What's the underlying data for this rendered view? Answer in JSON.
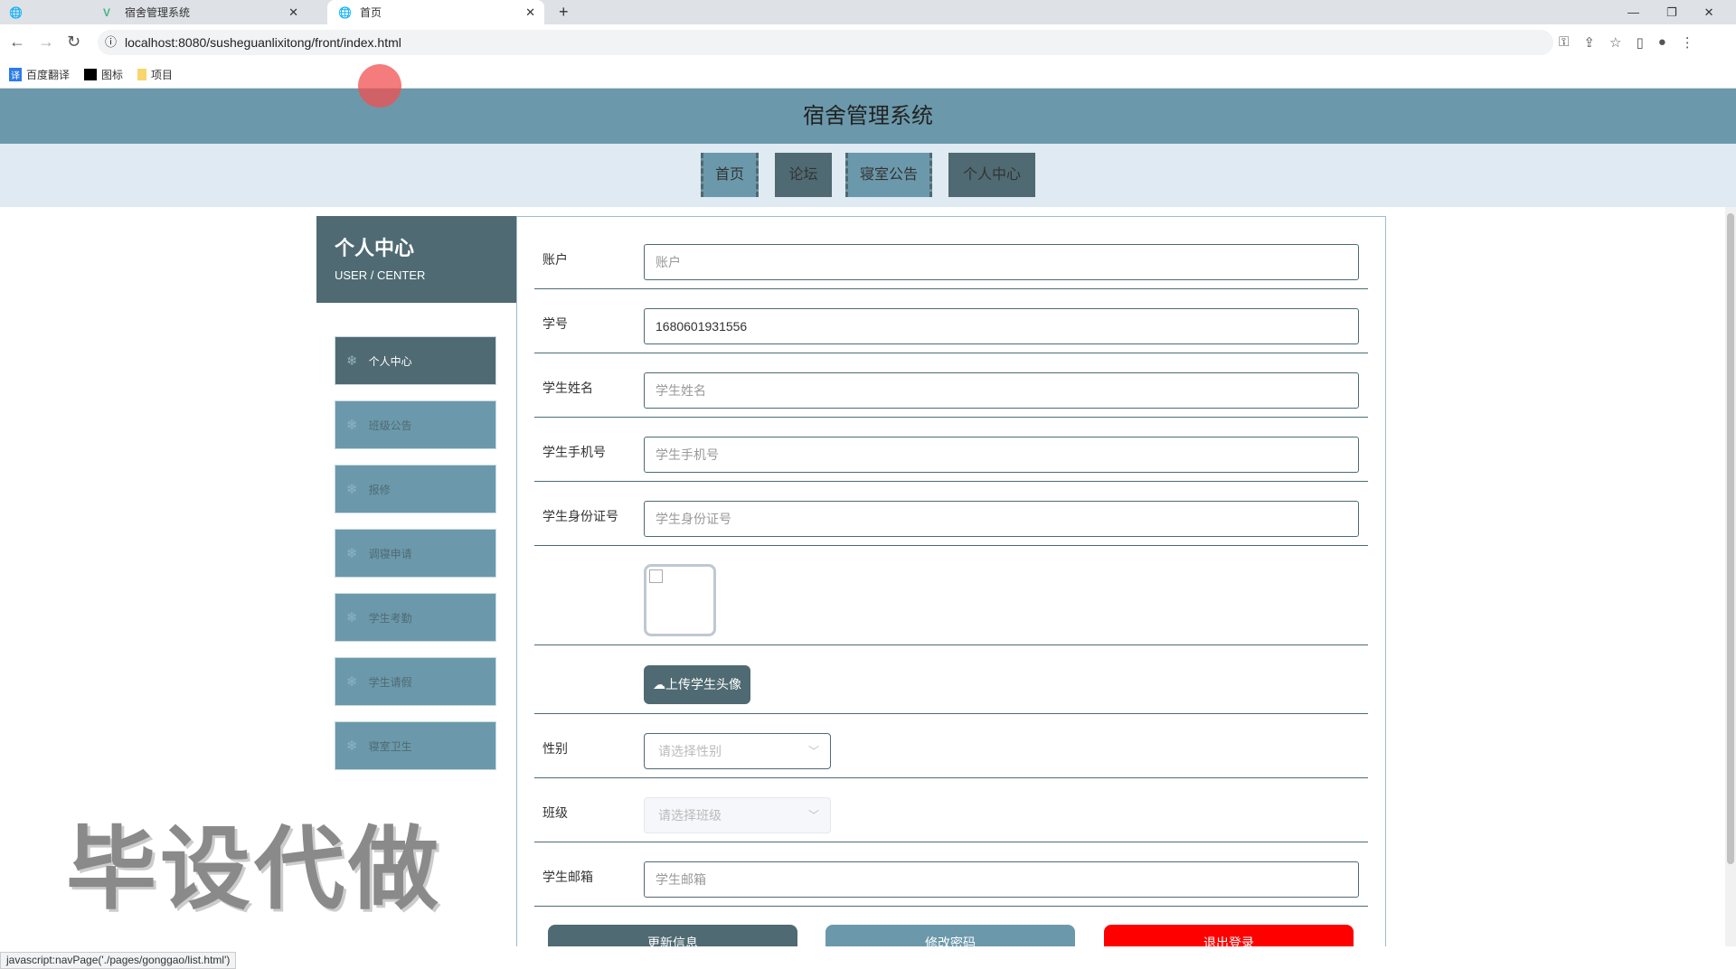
{
  "browser": {
    "tabs": [
      {
        "title": "宿舍管理系统"
      },
      {
        "title": "首页"
      }
    ],
    "url": "localhost:8080/susheguanlixitong/front/index.html",
    "bookmarks": [
      "百度翻译",
      "图标",
      "项目"
    ],
    "status": "javascript:navPage('./pages/gonggao/list.html')"
  },
  "header": {
    "title": "宿舍管理系统"
  },
  "nav": [
    "首页",
    "论坛",
    "寝室公告",
    "个人中心"
  ],
  "sidebar": {
    "title": "个人中心",
    "subtitle": "USER / CENTER",
    "items": [
      "个人中心",
      "班级公告",
      "报修",
      "调寝申请",
      "学生考勤",
      "学生请假",
      "寝室卫生"
    ]
  },
  "form": {
    "account": {
      "label": "账户",
      "placeholder": "账户"
    },
    "student_no": {
      "label": "学号",
      "value": "1680601931556"
    },
    "name": {
      "label": "学生姓名",
      "placeholder": "学生姓名"
    },
    "phone": {
      "label": "学生手机号",
      "placeholder": "学生手机号"
    },
    "id_card": {
      "label": "学生身份证号",
      "placeholder": "学生身份证号"
    },
    "upload": "上传学生头像",
    "gender": {
      "label": "性别",
      "placeholder": "请选择性别"
    },
    "class": {
      "label": "班级",
      "placeholder": "请选择班级"
    },
    "email": {
      "label": "学生邮箱",
      "placeholder": "学生邮箱"
    },
    "buttons": {
      "update": "更新信息",
      "password": "修改密码",
      "logout": "退出登录"
    }
  },
  "watermark": "毕设代做",
  "colors": {
    "light": "#6b99ab",
    "dark": "#4f6a72",
    "danger": "#ff0000"
  }
}
